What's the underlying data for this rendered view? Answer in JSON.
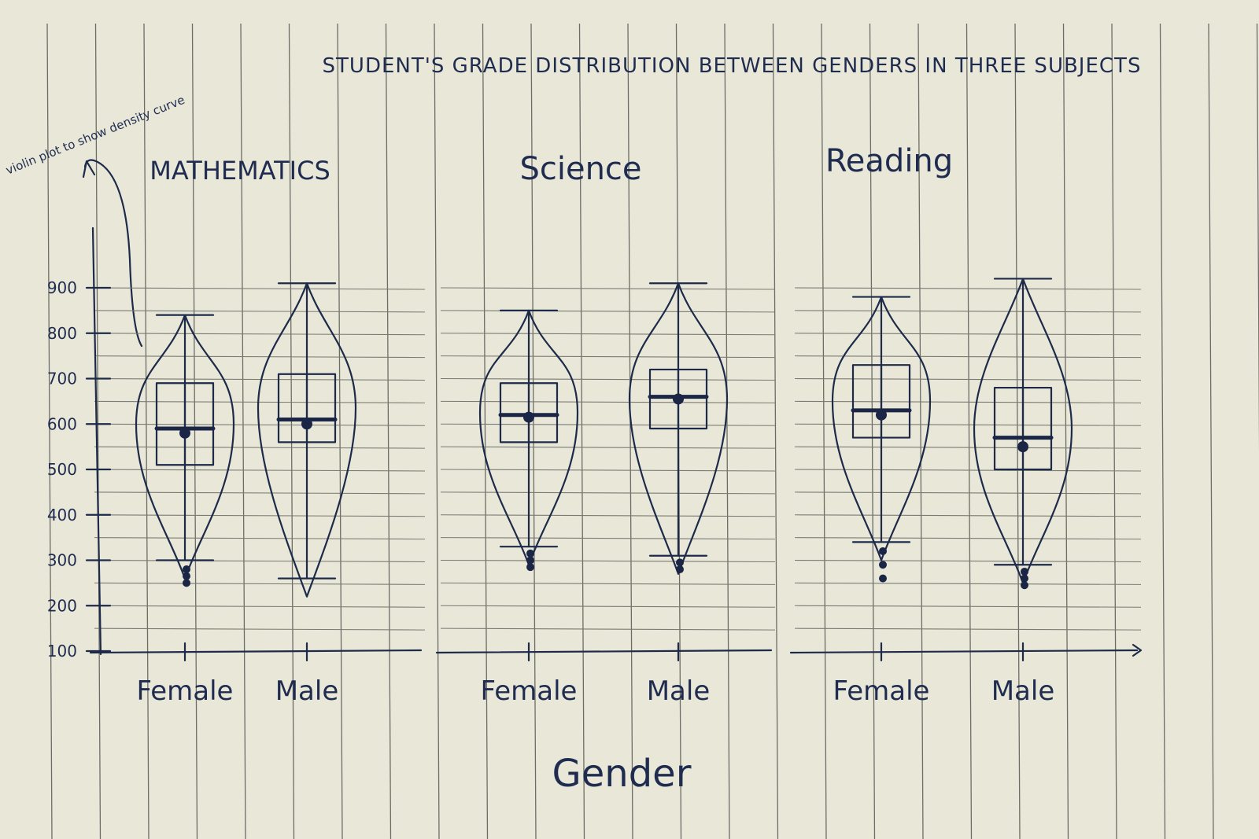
{
  "chart_data": {
    "type": "violin",
    "title": "STUDENT'S GRADE DISTRIBUTION BETWEEN GENDERS IN THREE SUBJECTS",
    "xlabel": "Gender",
    "ylabel": "",
    "ylim": [
      100,
      900
    ],
    "yticks": [
      100,
      200,
      300,
      400,
      500,
      600,
      700,
      800,
      900
    ],
    "ytick_labels": [
      "100",
      "200",
      "300",
      "400",
      "500",
      "600",
      "700",
      "800",
      "900"
    ],
    "annotation": "violin plot to show density curve",
    "grid": true,
    "subplots": [
      {
        "subject": "MATHEMATICS",
        "groups": [
          {
            "category": "Female",
            "min": 300,
            "q1": 510,
            "median": 590,
            "mean": 580,
            "q3": 690,
            "max": 840,
            "outliers": [
              280,
              265,
              250
            ]
          },
          {
            "category": "Male",
            "min": 260,
            "q1": 560,
            "median": 610,
            "mean": 600,
            "q3": 710,
            "max": 910,
            "outliers": []
          }
        ]
      },
      {
        "subject": "Science",
        "groups": [
          {
            "category": "Female",
            "min": 330,
            "q1": 560,
            "median": 620,
            "mean": 615,
            "q3": 690,
            "max": 850,
            "outliers": [
              315,
              300,
              285
            ]
          },
          {
            "category": "Male",
            "min": 310,
            "q1": 590,
            "median": 660,
            "mean": 655,
            "q3": 720,
            "max": 910,
            "outliers": [
              295,
              280
            ]
          }
        ]
      },
      {
        "subject": "Reading",
        "groups": [
          {
            "category": "Female",
            "min": 340,
            "q1": 570,
            "median": 630,
            "mean": 620,
            "q3": 730,
            "max": 880,
            "outliers": [
              320,
              290,
              260
            ]
          },
          {
            "category": "Male",
            "min": 290,
            "q1": 500,
            "median": 570,
            "mean": 550,
            "q3": 680,
            "max": 920,
            "outliers": [
              275,
              260,
              245
            ]
          }
        ]
      }
    ]
  }
}
